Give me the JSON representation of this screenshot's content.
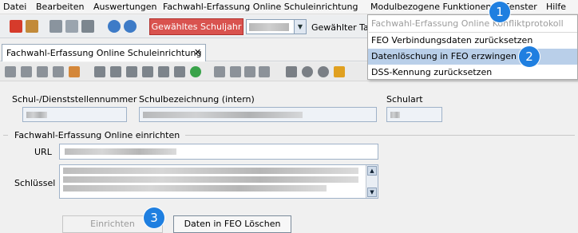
{
  "menubar": {
    "items": [
      "Datei",
      "Bearbeiten",
      "Auswertungen",
      "Fachwahl-Erfassung Online Schuleinrichtung",
      "Modulbezogene Funktionen",
      "Fenster",
      "Hilfe"
    ]
  },
  "toolbar": {
    "school_year_button": "Gewähltes Schuljahr",
    "day_label": "Gewählter Tag"
  },
  "tab": {
    "label": "Fachwahl-Erfassung Online Schuleinrichtung",
    "close": "✕"
  },
  "form": {
    "school_number_label": "Schul-/Dienststellennummer",
    "school_name_label": "Schulbezeichnung (intern)",
    "school_type_label": "Schulart",
    "group_label": "Fachwahl-Erfassung Online einrichten",
    "url_label": "URL",
    "key_label": "Schlüssel",
    "setup_button": "Einrichten",
    "delete_button": "Daten in FEO Löschen"
  },
  "dropdown": {
    "items": [
      {
        "label": "Fachwahl-Erfassung Online Konfliktprotokoll",
        "disabled": true
      },
      {
        "label": "FEO Verbindungsdaten zurücksetzen",
        "disabled": false
      },
      {
        "label": "Datenlöschung in FEO erzwingen",
        "disabled": false
      },
      {
        "label": "DSS-Kennung zurücksetzen",
        "disabled": false
      }
    ]
  },
  "badges": [
    "1",
    "2",
    "3"
  ],
  "colors": {
    "badge": "#1f7fe0",
    "red_button": "#d9534f",
    "highlight": "#b9cfe9"
  }
}
